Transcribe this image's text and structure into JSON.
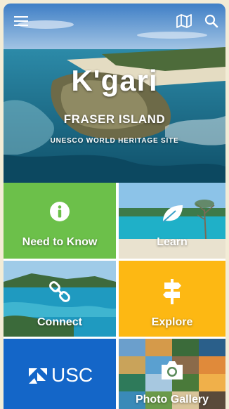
{
  "hero": {
    "title": "K'gari",
    "subtitle": "FRASER ISLAND",
    "tagline": "UNESCO WORLD HERITAGE SITE"
  },
  "toolbar": {
    "menu_icon": "hamburger-menu-icon",
    "map_icon": "map-icon",
    "search_icon": "search-icon"
  },
  "tiles": [
    {
      "label": "Need to Know",
      "icon": "info-icon",
      "color": "#6cc04a"
    },
    {
      "label": "Learn",
      "icon": "leaf-icon",
      "color": "#3aa0c8"
    },
    {
      "label": "Connect",
      "icon": "link-icon",
      "color": "#2a9ab8"
    },
    {
      "label": "Explore",
      "icon": "signpost-icon",
      "color": "#fdb813"
    },
    {
      "label": "USC",
      "icon": "usc-logo",
      "color": "#1466c8"
    },
    {
      "label": "Photo Gallery",
      "icon": "camera-icon",
      "color": "#5a8a5a"
    }
  ]
}
